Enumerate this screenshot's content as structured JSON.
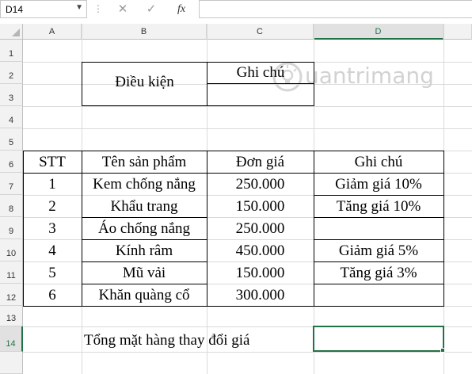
{
  "formula_bar": {
    "name_box": "D14",
    "name_box_arrow": "▼",
    "separator": "⋮",
    "cancel": "✕",
    "enter": "✓",
    "fx": "fx",
    "formula": ""
  },
  "columns": [
    "A",
    "B",
    "C",
    "D"
  ],
  "rows": [
    "1",
    "2",
    "3",
    "4",
    "5",
    "6",
    "7",
    "8",
    "9",
    "10",
    "11",
    "12",
    "13",
    "14"
  ],
  "condition_box": {
    "label": "Điều kiện",
    "header": "Ghi chú",
    "value": ""
  },
  "table": {
    "headers": [
      "STT",
      "Tên sản phẩm",
      "Đơn giá",
      "Ghi chú"
    ],
    "rows": [
      {
        "stt": "1",
        "name": "Kem chống nắng",
        "price": "250.000",
        "note": "Giảm giá 10%"
      },
      {
        "stt": "2",
        "name": "Khẩu trang",
        "price": "150.000",
        "note": "Tăng giá 10%"
      },
      {
        "stt": "3",
        "name": "Áo chống nắng",
        "price": "250.000",
        "note": ""
      },
      {
        "stt": "4",
        "name": "Kính râm",
        "price": "450.000",
        "note": "Giảm giá 5%"
      },
      {
        "stt": "5",
        "name": "Mũ vải",
        "price": "150.000",
        "note": "Tăng giá 3%"
      },
      {
        "stt": "6",
        "name": "Khăn quàng cổ",
        "price": "300.000",
        "note": ""
      }
    ]
  },
  "summary": {
    "label": "Tổng mặt hàng thay đổi giá",
    "value": ""
  },
  "watermark": {
    "text": "uantrimang",
    "icon": "lightbulb-icon"
  },
  "colors": {
    "accent": "#217346",
    "grid": "#dadada",
    "header_bg": "#f2f2f2"
  }
}
